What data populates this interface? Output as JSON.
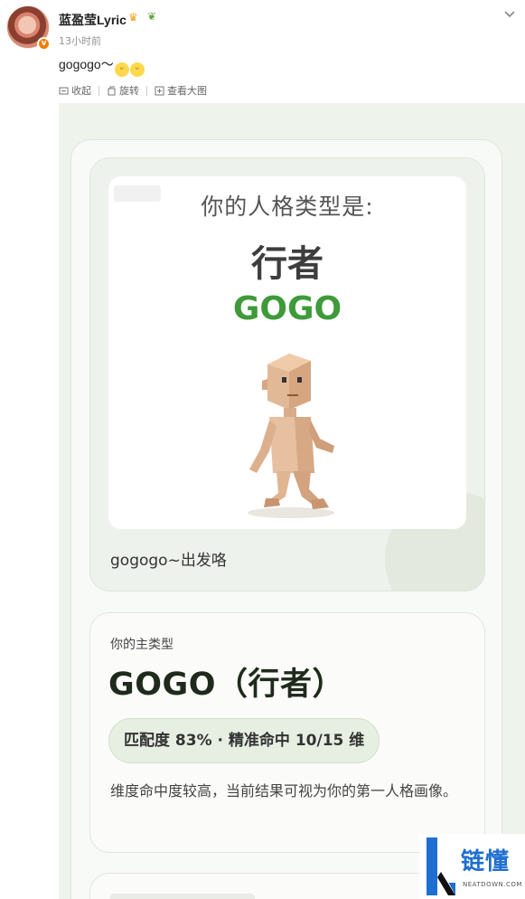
{
  "post": {
    "username": "蓝盈莹Lyric",
    "time": "13小时前",
    "text": "gogogo～",
    "emoji_count": 2,
    "icons": [
      "crown-icon",
      "sprout-icon",
      "chevron-down-icon",
      "verified-badge"
    ]
  },
  "toolbar": {
    "collapse_label": "收起",
    "rotate_label": "旋转",
    "view_large_label": "查看大图"
  },
  "result_image": {
    "heading": "你的人格类型是:",
    "type_cn": "行者",
    "type_en": "GOGO",
    "caption": "gogogo~出发咯",
    "primary_type_label": "你的主类型",
    "primary_type_title": "GOGO（行者）",
    "match_text": "匹配度 83% · 精准命中 10/15 维",
    "match_percent": 83,
    "dimensions_hit": 10,
    "dimensions_total": 15,
    "description": "维度命中度较高，当前结果可视为你的第一人格画像。"
  },
  "watermark": {
    "brand_cn": "链懂",
    "brand_en": "NEATDOWN.COM",
    "colors": {
      "brand_blue": "#1f6fd0",
      "accent_green": "#3f9a3a"
    }
  }
}
